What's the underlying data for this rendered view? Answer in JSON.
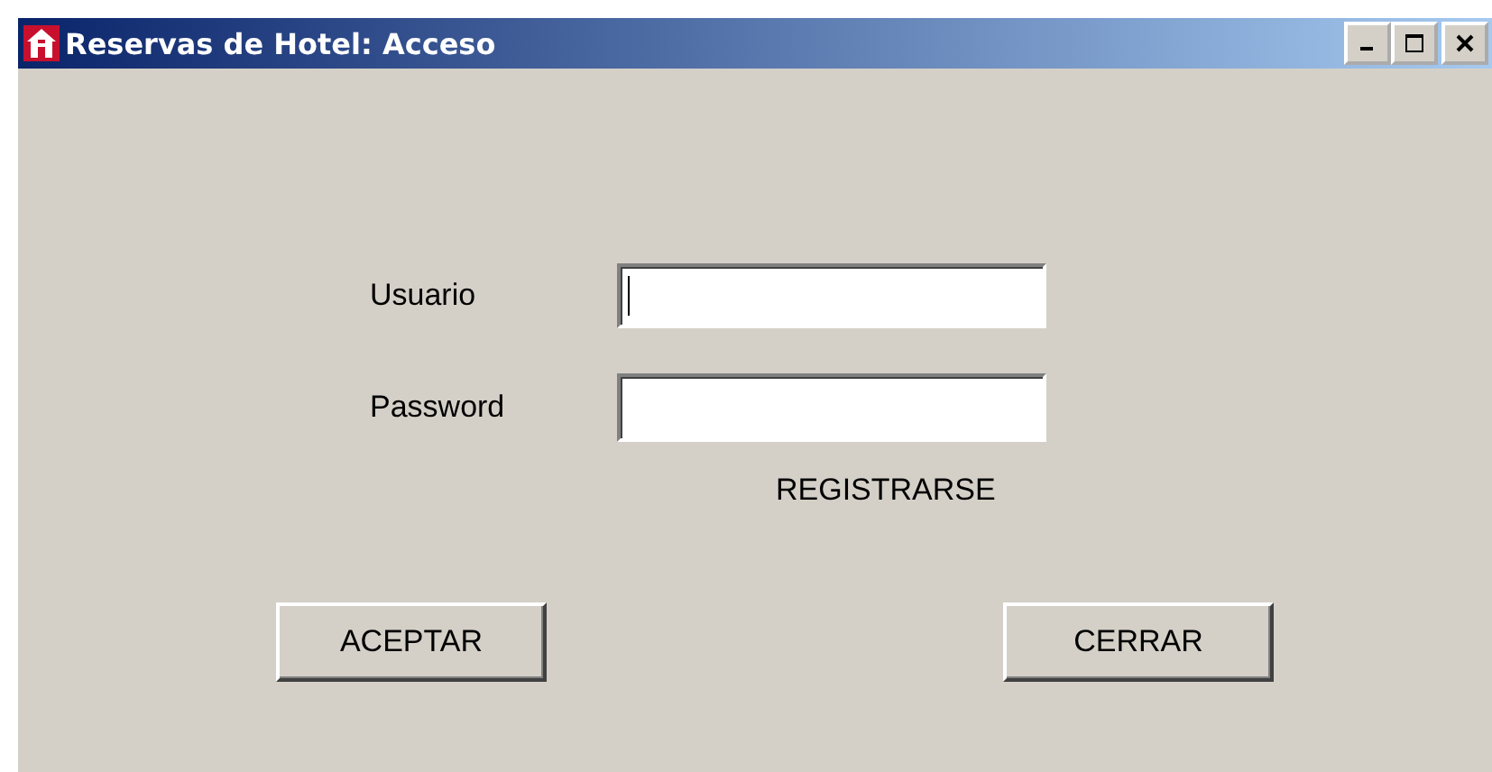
{
  "window": {
    "title": "Reservas de Hotel: Acceso"
  },
  "fields": [
    {
      "label": "Usuario",
      "focused": true,
      "kind": "text"
    },
    {
      "label": "Password",
      "focused": false,
      "kind": "password"
    }
  ],
  "register_link": "REGISTRARSE",
  "buttons": [
    "ACEPTAR",
    "CERRAR"
  ]
}
